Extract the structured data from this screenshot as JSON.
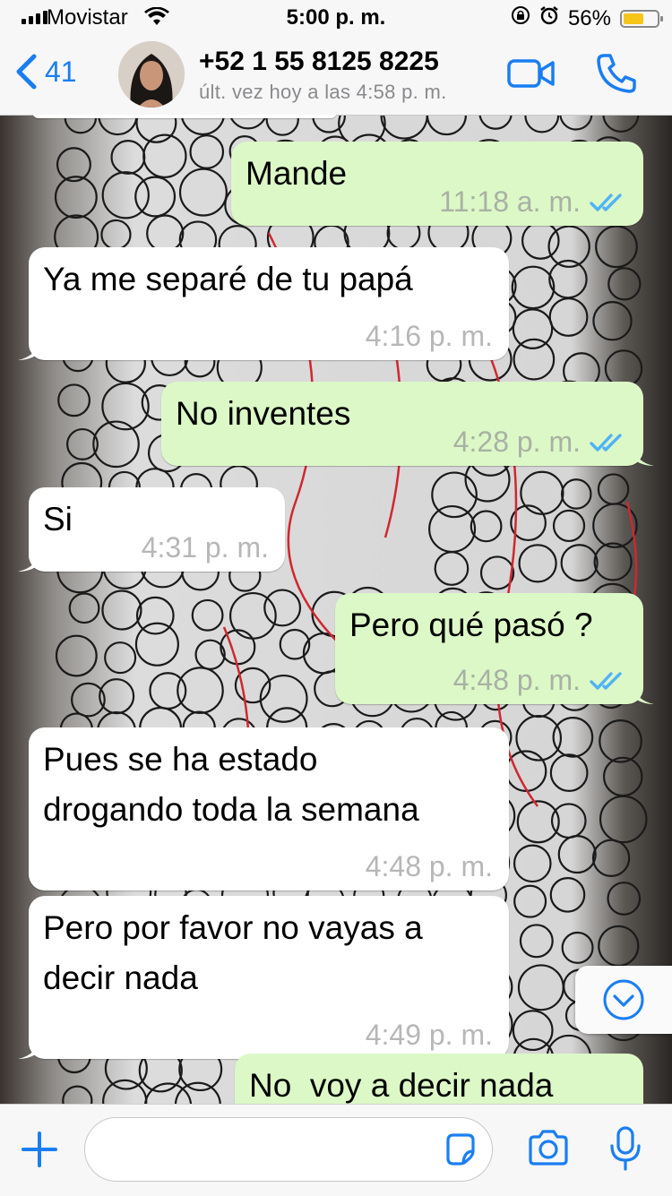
{
  "status_bar": {
    "carrier": "Movistar",
    "time": "5:00 p. m.",
    "battery": "56%"
  },
  "header": {
    "back_count": "41",
    "contact_name": "+52 1 55 8125 8225",
    "last_seen": "últ. vez hoy a las 4:58 p. m."
  },
  "messages": [
    {
      "direction": "out",
      "text": "Mande",
      "time": "11:18 a. m.",
      "read": true
    },
    {
      "direction": "in",
      "text": "Ya me separé de tu papá",
      "time": "4:16 p. m."
    },
    {
      "direction": "out",
      "text": "No inventes",
      "time": "4:28 p. m.",
      "read": true
    },
    {
      "direction": "in",
      "text": "Si",
      "time": "4:31 p. m."
    },
    {
      "direction": "out",
      "text": "Pero qué pasó ?",
      "time": "4:48 p. m.",
      "read": true
    },
    {
      "direction": "in",
      "text": "Pues se ha estado\ndrogando toda la semana",
      "time": "4:48 p. m."
    },
    {
      "direction": "in",
      "text": "Pero por favor no vayas a\ndecir nada",
      "time": "4:49 p. m."
    },
    {
      "direction": "out",
      "text": "No  voy a decir nada",
      "time": ""
    }
  ],
  "input": {
    "value": "",
    "placeholder": ""
  },
  "colors": {
    "accent": "#1a7ef2",
    "outgoing_bubble": "#dcf8c6",
    "incoming_bubble": "#ffffff",
    "read_ticks": "#4fb3f6"
  },
  "icons": [
    "signal-icon",
    "wifi-icon",
    "lock-rotation-icon",
    "alarm-icon",
    "battery-icon",
    "back-chevron-icon",
    "video-call-icon",
    "phone-icon",
    "read-ticks-icon",
    "scroll-down-icon",
    "plus-icon",
    "sticker-icon",
    "camera-icon",
    "microphone-icon"
  ]
}
